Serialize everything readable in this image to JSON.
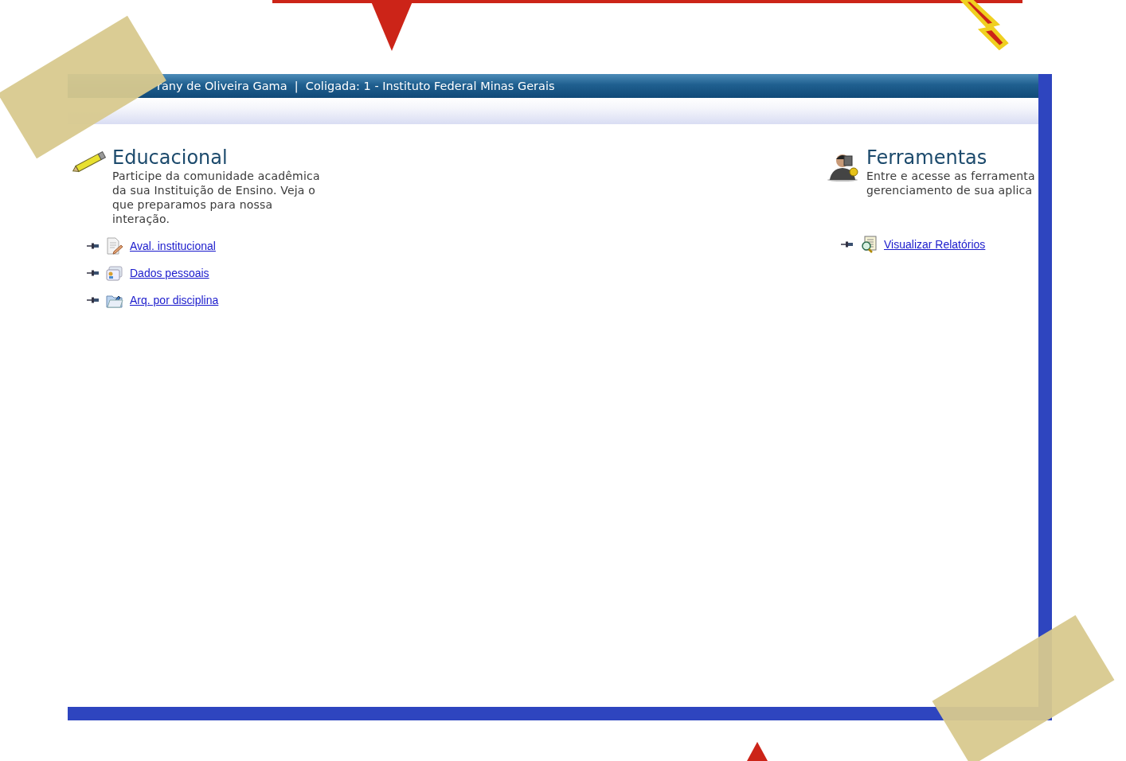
{
  "header": {
    "text": "rany de Oliveira Gama  |  Coligada: 1 - Instituto Federal Minas Gerais"
  },
  "sections": [
    {
      "title": "Educacional",
      "description_lines": [
        "Participe da comunidade acadêmica",
        "da sua Instituição de Ensino. Veja o",
        "que preparamos para nossa",
        "interação."
      ],
      "links": [
        {
          "label": "Aval. institucional"
        },
        {
          "label": "Dados pessoais"
        },
        {
          "label": "Arq. por disciplina"
        }
      ]
    },
    {
      "title": "Ferramentas",
      "description_lines": [
        "Entre e acesse as ferramenta",
        "gerenciamento de sua aplica"
      ],
      "links": [
        {
          "label": "Visualizar Relatórios"
        }
      ]
    }
  ]
}
